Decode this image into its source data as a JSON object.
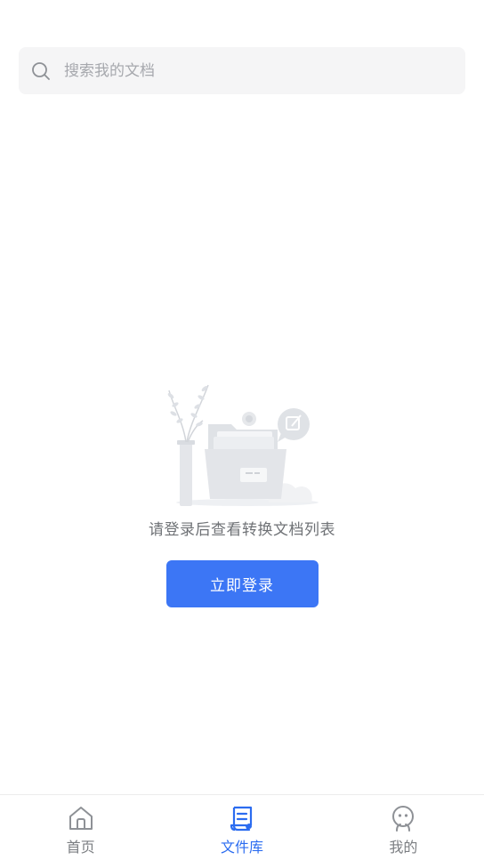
{
  "search": {
    "placeholder": "搜索我的文档"
  },
  "empty_state": {
    "message": "请登录后查看转换文档列表",
    "login_button": "立即登录"
  },
  "tabs": [
    {
      "label": "首页",
      "icon": "home-icon",
      "active": false
    },
    {
      "label": "文件库",
      "icon": "document-library-icon",
      "active": true
    },
    {
      "label": "我的",
      "icon": "profile-icon",
      "active": false
    }
  ],
  "colors": {
    "accent": "#3c76f5",
    "active_tab": "#2b6cf0",
    "inactive_tab": "#7b7e82",
    "search_bg": "#f5f5f6"
  }
}
